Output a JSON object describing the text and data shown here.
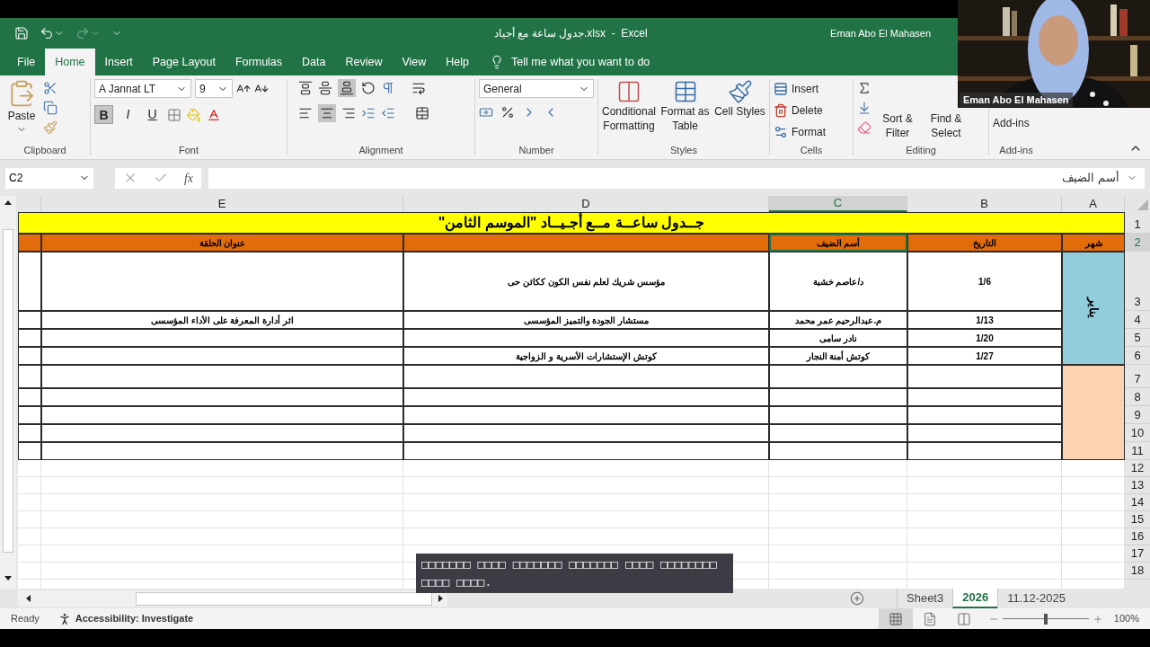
{
  "title_bar": {
    "document_title": "جدول ساعة مع أجياد.xlsx  -  Excel",
    "user": "Eman Abo El Mahasen",
    "redo_disabled": true
  },
  "ribbon_tabs": [
    {
      "label": "File",
      "selected": false
    },
    {
      "label": "Home",
      "selected": true
    },
    {
      "label": "Insert",
      "selected": false
    },
    {
      "label": "Page Layout",
      "selected": false
    },
    {
      "label": "Formulas",
      "selected": false
    },
    {
      "label": "Data",
      "selected": false
    },
    {
      "label": "Review",
      "selected": false
    },
    {
      "label": "View",
      "selected": false
    },
    {
      "label": "Help",
      "selected": false
    }
  ],
  "tell_me": "Tell me what you want to do",
  "ribbon": {
    "clipboard": {
      "paste": "Paste",
      "label": "Clipboard"
    },
    "font": {
      "name": "A Jannat LT",
      "size": "9",
      "label": "Font",
      "styles": [
        {
          "label": "B",
          "selected": true
        },
        {
          "label": "I",
          "selected": false
        },
        {
          "label": "U",
          "selected": false
        }
      ]
    },
    "alignment": {
      "label": "Alignment",
      "bottom_align": true,
      "center": true
    },
    "number": {
      "format": "General",
      "label": "Number"
    },
    "styles": {
      "buttons": [
        "Conditional Formatting",
        "Format as Table",
        "Cell Styles"
      ],
      "label": "Styles"
    },
    "cells": {
      "buttons": [
        "Insert",
        "Delete",
        "Format"
      ],
      "label": "Cells"
    },
    "editing": {
      "buttons": [
        "Sort & Filter",
        "Find & Select"
      ],
      "label": "Editing"
    },
    "addins": {
      "button": "Add-ins",
      "label": "Add-ins"
    }
  },
  "formula_bar": {
    "name_box": "C2",
    "fx": "fx",
    "value": "أسم الضيف"
  },
  "column_headers": [
    {
      "label": "E",
      "selected": false
    },
    {
      "label": "D",
      "selected": false
    },
    {
      "label": "C",
      "selected": true
    },
    {
      "label": "B",
      "selected": false
    },
    {
      "label": "A",
      "selected": false
    }
  ],
  "row_headers": [
    {
      "label": "1",
      "selected": false
    },
    {
      "label": "2",
      "selected": true
    },
    {
      "label": "3",
      "selected": false
    },
    {
      "label": "4",
      "selected": false
    },
    {
      "label": "5",
      "selected": false
    },
    {
      "label": "6",
      "selected": false
    },
    {
      "label": "7",
      "selected": false
    },
    {
      "label": "8",
      "selected": false
    },
    {
      "label": "9",
      "selected": false
    },
    {
      "label": "10",
      "selected": false
    },
    {
      "label": "11",
      "selected": false
    },
    {
      "label": "12",
      "selected": false
    },
    {
      "label": "13",
      "selected": false
    },
    {
      "label": "14",
      "selected": false
    },
    {
      "label": "15",
      "selected": false
    },
    {
      "label": "16",
      "selected": false
    },
    {
      "label": "17",
      "selected": false
    },
    {
      "label": "18",
      "selected": false
    }
  ],
  "sheet": {
    "title": "جــدول ساعــة مــع أجـيــاد \"الموسم الثامن\"",
    "header_cells": [
      {
        "text": "شهر",
        "selected": false
      },
      {
        "text": "التاريخ",
        "selected": false
      },
      {
        "text": "أسم الضيف",
        "selected": true
      },
      {
        "selected": false
      },
      {
        "text": "عنوان الحلقة",
        "selected": false
      },
      {
        "selected": false
      }
    ],
    "months": [
      {
        "label": "يناير",
        "color": "#92cddc",
        "rows": [
          {
            "date": "1/6",
            "guest": "د/عاصم خشبة",
            "column_d": "مؤسس شريك لعلم نفس الكون ككائن حى"
          },
          {
            "date": "1/13",
            "guest": "م.عبدالرحيم عمر محمد",
            "column_d": "مستشار الجودة والتميز المؤسسى",
            "episode_title": "اثر أدارة المعرفة على الأداء المؤسسى"
          },
          {
            "date": "1/20",
            "guest": "نادر سامى"
          },
          {
            "date": "1/27",
            "guest": "كوتش أمنة النجار",
            "column_d": "كوتش الإستشارات الأسرية و الزواجية"
          }
        ]
      },
      {
        "color": "#fcd3b2",
        "rows": [
          {},
          {},
          {},
          {},
          {}
        ]
      }
    ]
  },
  "sheet_tabs": [
    {
      "label": "Sheet3",
      "selected": false
    },
    {
      "label": "2026",
      "selected": true
    },
    {
      "label": "11.12-2025",
      "selected": false
    }
  ],
  "status_bar": {
    "ready": "Ready",
    "accessibility": "Accessibility: Investigate",
    "zoom": {
      "level": 0.5,
      "reading": "100%"
    }
  },
  "caption": "□□□□□□□ □□□□ □□□□□□□ □□□□□□□ □□□□ □□□□□□□□ □□□□ □□□□.",
  "video_label": "Eman Abo El Mahasen"
}
